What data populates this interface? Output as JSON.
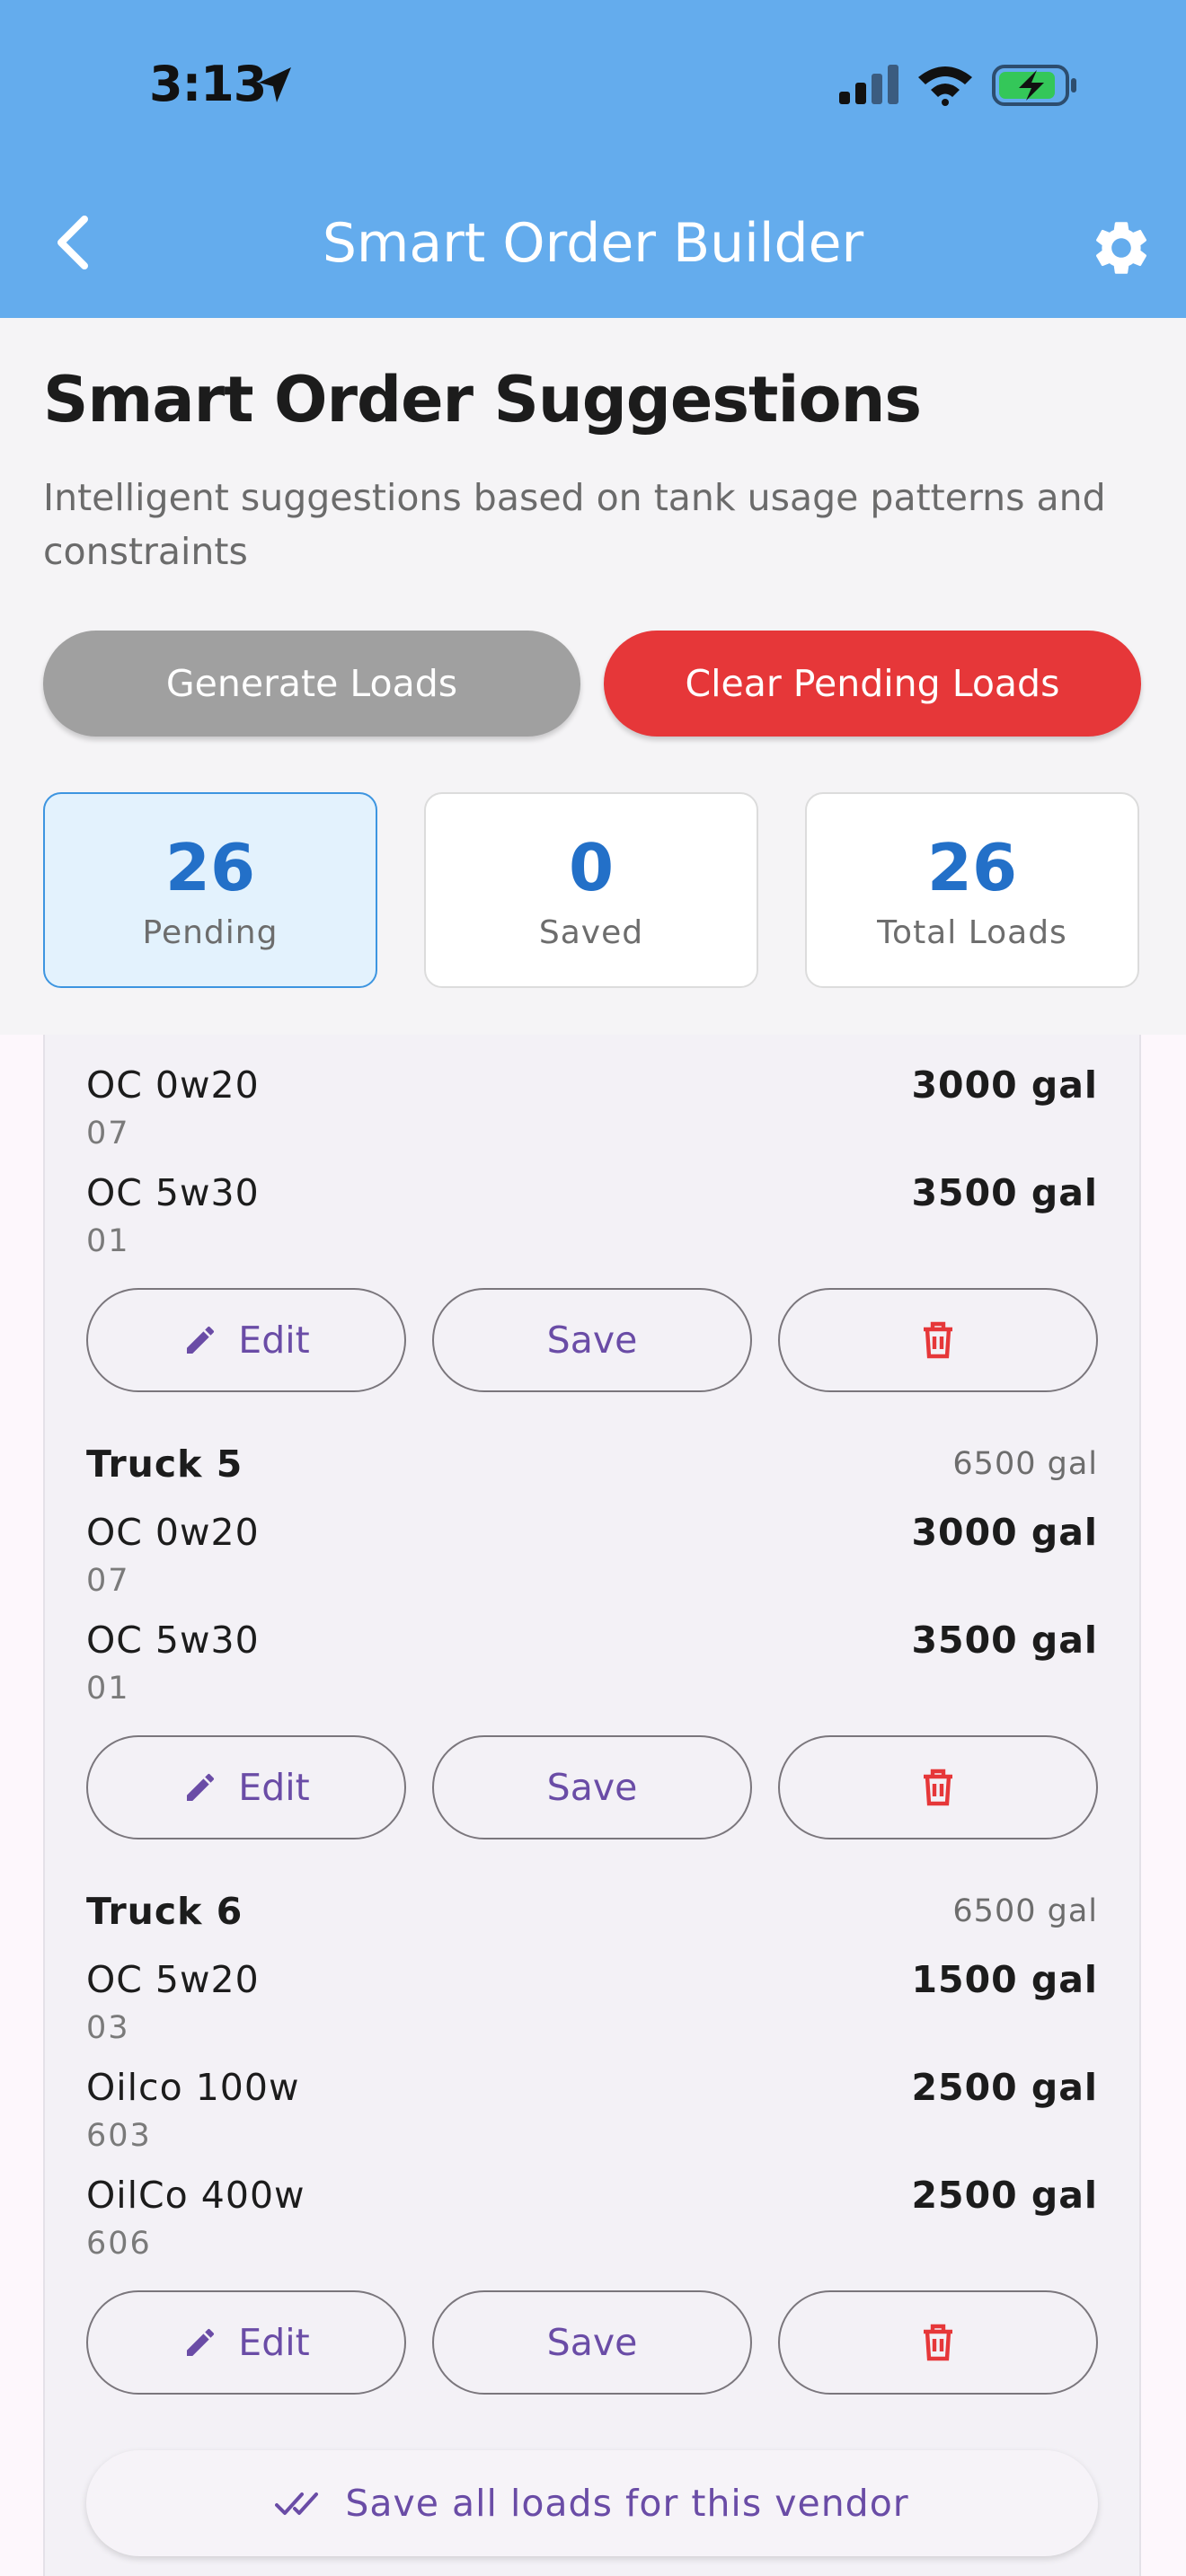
{
  "status_bar": {
    "time": "3:13"
  },
  "app_bar": {
    "title": "Smart Order Builder"
  },
  "header": {
    "title": "Smart Order Suggestions",
    "subtitle": "Intelligent suggestions based on tank usage patterns and constraints",
    "generate_label": "Generate Loads",
    "clear_label": "Clear Pending Loads"
  },
  "stats": [
    {
      "value": "26",
      "label": "Pending"
    },
    {
      "value": "0",
      "label": "Saved"
    },
    {
      "value": "26",
      "label": "Total Loads"
    }
  ],
  "partial_truck": {
    "items": [
      {
        "name": "OC 0w20",
        "code": "07",
        "qty": "3000 gal"
      },
      {
        "name": "OC 5w30",
        "code": "01",
        "qty": "3500 gal"
      }
    ]
  },
  "trucks": [
    {
      "name": "Truck 5",
      "total": "6500 gal",
      "items": [
        {
          "name": "OC 0w20",
          "code": "07",
          "qty": "3000 gal"
        },
        {
          "name": "OC 5w30",
          "code": "01",
          "qty": "3500 gal"
        }
      ]
    },
    {
      "name": "Truck 6",
      "total": "6500 gal",
      "items": [
        {
          "name": "OC 5w20",
          "code": "03",
          "qty": "1500 gal"
        },
        {
          "name": "Oilco 100w",
          "code": "603",
          "qty": "2500 gal"
        },
        {
          "name": "OilCo 400w",
          "code": "606",
          "qty": "2500 gal"
        }
      ]
    }
  ],
  "actions": {
    "edit_label": "Edit",
    "save_label": "Save"
  },
  "save_all_label": "Save all loads for this vendor",
  "colors": {
    "app_bar": "#64aced",
    "danger": "#e63739",
    "accent_blue": "#2370c8",
    "accent_purple": "#6a4ca6"
  }
}
